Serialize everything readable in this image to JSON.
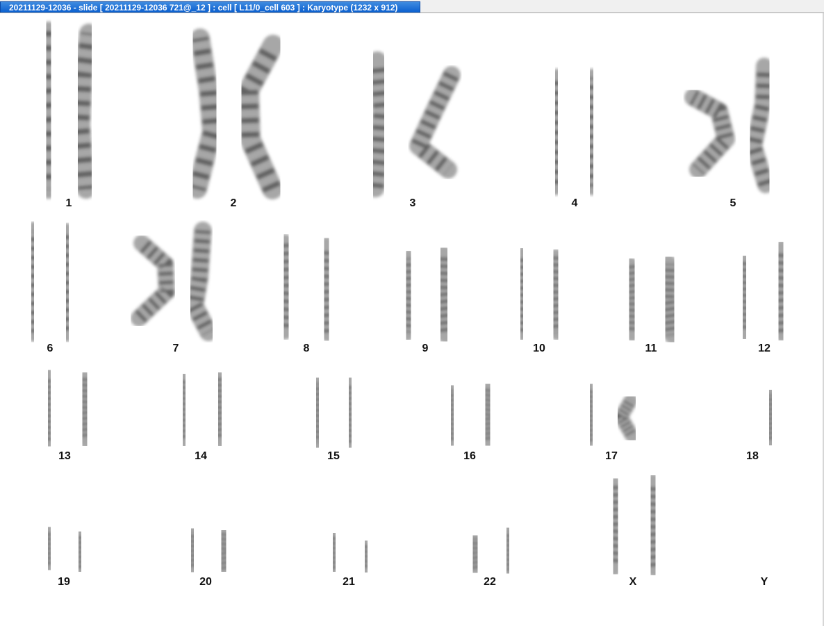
{
  "window": {
    "title": "20211129-12036 - slide [ 20211129-12036 721@_12 ] : cell [ L11/0_cell 603 ] : Karyotype  (1232 x 912)"
  },
  "karyotype": {
    "labels": [
      "1",
      "2",
      "3",
      "4",
      "5",
      "6",
      "7",
      "8",
      "9",
      "10",
      "11",
      "12",
      "13",
      "14",
      "15",
      "16",
      "17",
      "18",
      "19",
      "20",
      "21",
      "22",
      "X",
      "Y"
    ],
    "colors": {
      "chromatin": "#8a8a8a",
      "dark_band": "#2a2a2a",
      "label": "#111111"
    }
  }
}
